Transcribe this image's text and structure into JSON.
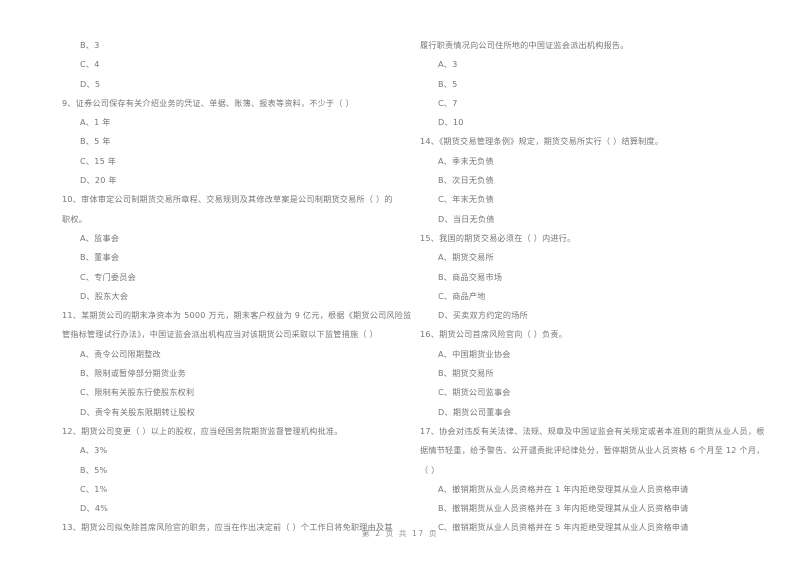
{
  "document": {
    "page_background": "#ffffff",
    "text_color": "#76767a",
    "footer": "第 2 页 共 17 页",
    "page_number": "2",
    "total_pages": "17"
  },
  "left_column": {
    "blocks": [
      {
        "type": "orphan_options",
        "lines": [
          "B、3",
          "C、4",
          "D、5"
        ]
      },
      {
        "type": "question",
        "number": "9",
        "stem": "9、证券公司保存有关介绍业务的凭证、单据、账簿、报表等资料，不少于（      ）",
        "options": [
          "A、1 年",
          "B、5 年",
          "C、15 年",
          "D、20 年"
        ]
      },
      {
        "type": "question",
        "number": "10",
        "stem": "10、审体审定公司制期货交易所章程、交易规则及其修改草案是公司制期货交易所（      ）的",
        "stem_cont": "职权。",
        "options": [
          "A、监事会",
          "B、董事会",
          "C、专门委员会",
          "D、股东大会"
        ]
      },
      {
        "type": "question",
        "number": "11",
        "stem": "11、某期货公司的期末净资本为 5000 万元，期末客户权益为 9 亿元，根据《期货公司风险监",
        "stem_cont": "管指标管理试行办法》，中国证监会派出机构应当对该期货公司采取以下监管措施（      ）",
        "options": [
          "A、责令公司限期整改",
          "B、限制或暂停部分期货业务",
          "C、限制有关股东行使股东权利",
          "D、责令有关股东限期转让股权"
        ]
      },
      {
        "type": "question",
        "number": "12",
        "stem": "12、期货公司变更（      ）以上的股权，应当经国务院期货监督管理机构批准。",
        "options": [
          "A、3%",
          "B、5%",
          "C、1%",
          "D、4%"
        ]
      },
      {
        "type": "question",
        "number": "13",
        "stem": "13、期货公司拟免除首席风险官的职务，应当在作出决定前（      ）个工作日将免职理由及其",
        "options": []
      }
    ]
  },
  "right_column": {
    "blocks": [
      {
        "type": "continuation",
        "lines": [
          "履行职责情况向公司住所地的中国证监会派出机构报告。"
        ],
        "options": [
          "A、3",
          "B、5",
          "C、7",
          "D、10"
        ]
      },
      {
        "type": "question",
        "number": "14",
        "stem": "14、《期货交易管理条例》规定，期货交易所实行（      ）结算制度。",
        "options": [
          "A、季末无负债",
          "B、次日无负债",
          "C、年末无负债",
          "D、当日无负债"
        ]
      },
      {
        "type": "question",
        "number": "15",
        "stem": "15、我国的期货交易必须在（      ）内进行。",
        "options": [
          "A、期货交易所",
          "B、商品交易市场",
          "C、商品产地",
          "D、买卖双方约定的场所"
        ]
      },
      {
        "type": "question",
        "number": "16",
        "stem": "16、期货公司首席风险官向（      ）负责。",
        "options": [
          "A、中国期货业协会",
          "B、期货交易所",
          "C、期货公司监事会",
          "D、期货公司董事会"
        ]
      },
      {
        "type": "question",
        "number": "17",
        "stem": "17、协会对违反有关法律、法规、规章及中国证监会有关规定或者本准则的期货从业人员，根",
        "stem_cont": "据情节轻重，给予警告、公开谴责批评纪律处分，暂停期货从业人员资格 6 个月至 12 个月，",
        "stem_cont2": "（      ）",
        "options": [
          "A、撤销期货从业人员资格并在 1 年内拒绝受理其从业人员资格申请",
          "B、撤销期货从业人员资格并在 3 年内拒绝受理其从业人员资格申请",
          "C、撤销期货从业人员资格并在 5 年内拒绝受理其从业人员资格申请"
        ]
      }
    ]
  }
}
